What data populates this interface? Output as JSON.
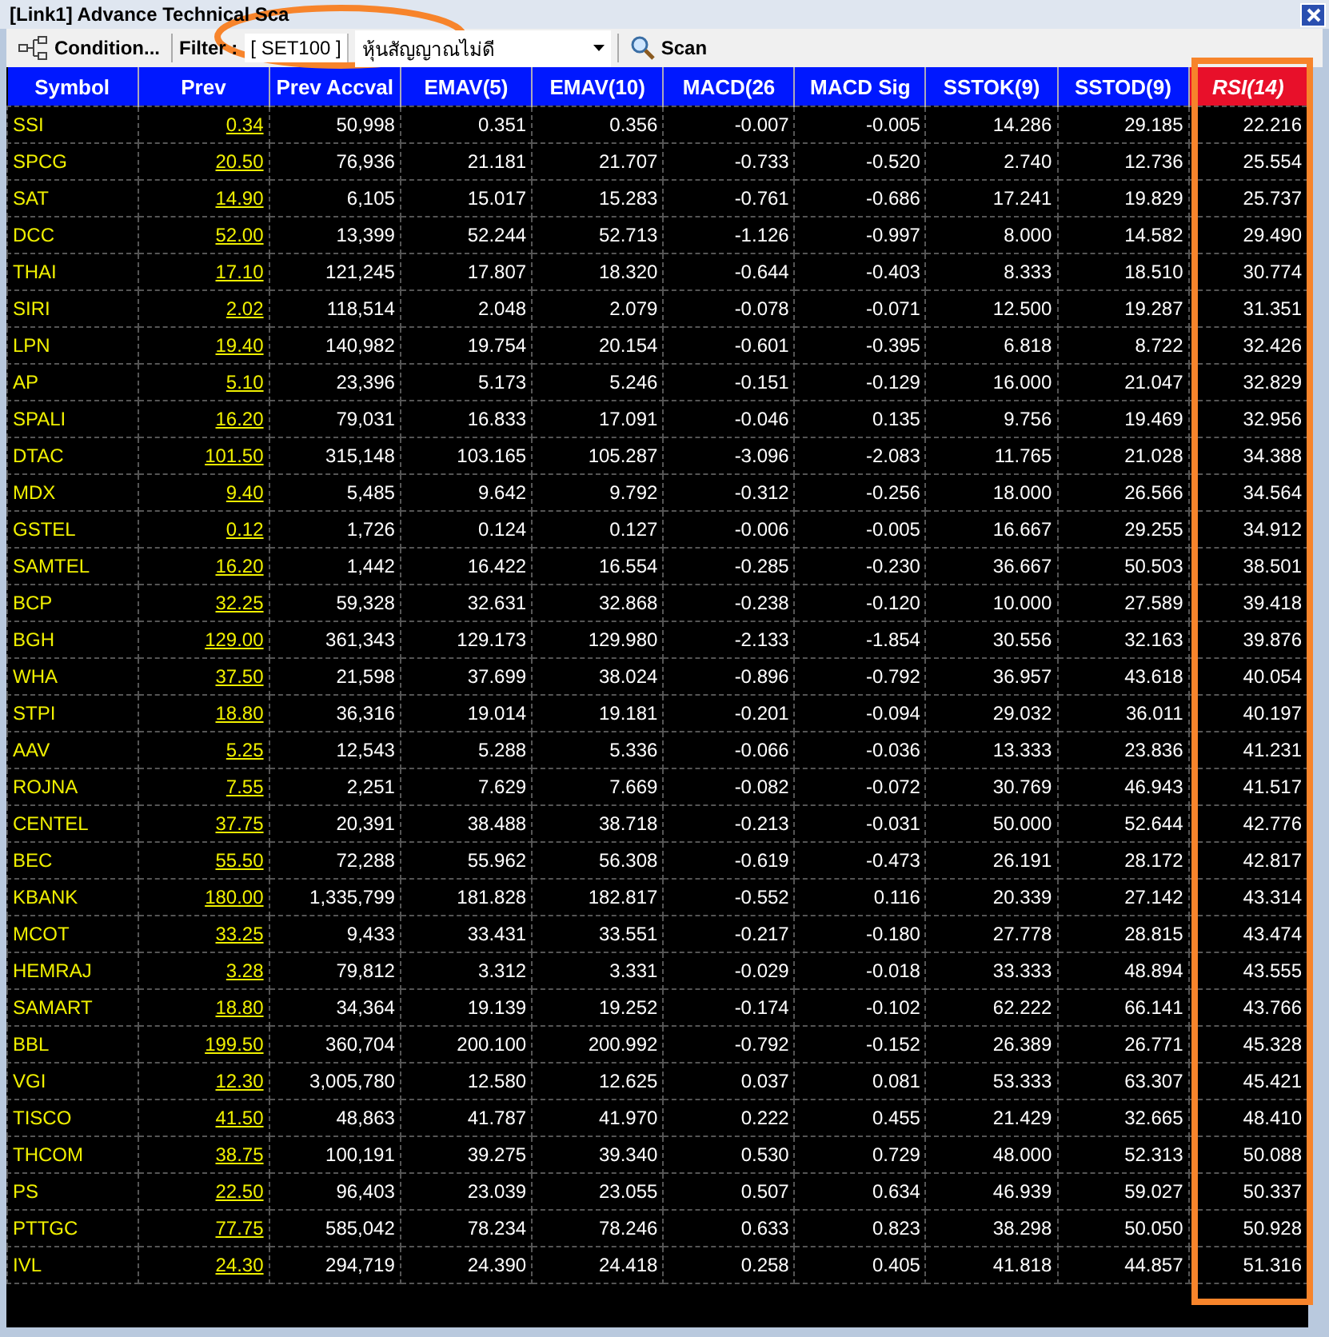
{
  "window": {
    "title": "[Link1] Advance Technical Sca"
  },
  "toolbar": {
    "condition_button": "Condition...",
    "filter_label": "Filter :",
    "filter_value": "[ SET100 ]",
    "signal_dropdown": "หุ้นสัญญาณไม่ดี",
    "scan_button": "Scan"
  },
  "table": {
    "columns": [
      {
        "label": "Symbol",
        "kind": "symbol",
        "sorted": false
      },
      {
        "label": "Prev",
        "kind": "link",
        "sorted": false
      },
      {
        "label": "Prev Accval",
        "kind": "number",
        "sorted": false
      },
      {
        "label": "EMAV(5)",
        "kind": "number",
        "sorted": false
      },
      {
        "label": "EMAV(10)",
        "kind": "number",
        "sorted": false
      },
      {
        "label": "MACD(26",
        "kind": "number",
        "sorted": false
      },
      {
        "label": "MACD Sig",
        "kind": "number",
        "sorted": false
      },
      {
        "label": "SSTOK(9)",
        "kind": "number",
        "sorted": false
      },
      {
        "label": "SSTOD(9)",
        "kind": "number",
        "sorted": false
      },
      {
        "label": "RSI(14)",
        "kind": "number",
        "sorted": true
      }
    ],
    "rows": [
      [
        "SSI",
        "0.34",
        "50,998",
        "0.351",
        "0.356",
        "-0.007",
        "-0.005",
        "14.286",
        "29.185",
        "22.216"
      ],
      [
        "SPCG",
        "20.50",
        "76,936",
        "21.181",
        "21.707",
        "-0.733",
        "-0.520",
        "2.740",
        "12.736",
        "25.554"
      ],
      [
        "SAT",
        "14.90",
        "6,105",
        "15.017",
        "15.283",
        "-0.761",
        "-0.686",
        "17.241",
        "19.829",
        "25.737"
      ],
      [
        "DCC",
        "52.00",
        "13,399",
        "52.244",
        "52.713",
        "-1.126",
        "-0.997",
        "8.000",
        "14.582",
        "29.490"
      ],
      [
        "THAI",
        "17.10",
        "121,245",
        "17.807",
        "18.320",
        "-0.644",
        "-0.403",
        "8.333",
        "18.510",
        "30.774"
      ],
      [
        "SIRI",
        "2.02",
        "118,514",
        "2.048",
        "2.079",
        "-0.078",
        "-0.071",
        "12.500",
        "19.287",
        "31.351"
      ],
      [
        "LPN",
        "19.40",
        "140,982",
        "19.754",
        "20.154",
        "-0.601",
        "-0.395",
        "6.818",
        "8.722",
        "32.426"
      ],
      [
        "AP",
        "5.10",
        "23,396",
        "5.173",
        "5.246",
        "-0.151",
        "-0.129",
        "16.000",
        "21.047",
        "32.829"
      ],
      [
        "SPALI",
        "16.20",
        "79,031",
        "16.833",
        "17.091",
        "-0.046",
        "0.135",
        "9.756",
        "19.469",
        "32.956"
      ],
      [
        "DTAC",
        "101.50",
        "315,148",
        "103.165",
        "105.287",
        "-3.096",
        "-2.083",
        "11.765",
        "21.028",
        "34.388"
      ],
      [
        "MDX",
        "9.40",
        "5,485",
        "9.642",
        "9.792",
        "-0.312",
        "-0.256",
        "18.000",
        "26.566",
        "34.564"
      ],
      [
        "GSTEL",
        "0.12",
        "1,726",
        "0.124",
        "0.127",
        "-0.006",
        "-0.005",
        "16.667",
        "29.255",
        "34.912"
      ],
      [
        "SAMTEL",
        "16.20",
        "1,442",
        "16.422",
        "16.554",
        "-0.285",
        "-0.230",
        "36.667",
        "50.503",
        "38.501"
      ],
      [
        "BCP",
        "32.25",
        "59,328",
        "32.631",
        "32.868",
        "-0.238",
        "-0.120",
        "10.000",
        "27.589",
        "39.418"
      ],
      [
        "BGH",
        "129.00",
        "361,343",
        "129.173",
        "129.980",
        "-2.133",
        "-1.854",
        "30.556",
        "32.163",
        "39.876"
      ],
      [
        "WHA",
        "37.50",
        "21,598",
        "37.699",
        "38.024",
        "-0.896",
        "-0.792",
        "36.957",
        "43.618",
        "40.054"
      ],
      [
        "STPI",
        "18.80",
        "36,316",
        "19.014",
        "19.181",
        "-0.201",
        "-0.094",
        "29.032",
        "36.011",
        "40.197"
      ],
      [
        "AAV",
        "5.25",
        "12,543",
        "5.288",
        "5.336",
        "-0.066",
        "-0.036",
        "13.333",
        "23.836",
        "41.231"
      ],
      [
        "ROJNA",
        "7.55",
        "2,251",
        "7.629",
        "7.669",
        "-0.082",
        "-0.072",
        "30.769",
        "46.943",
        "41.517"
      ],
      [
        "CENTEL",
        "37.75",
        "20,391",
        "38.488",
        "38.718",
        "-0.213",
        "-0.031",
        "50.000",
        "52.644",
        "42.776"
      ],
      [
        "BEC",
        "55.50",
        "72,288",
        "55.962",
        "56.308",
        "-0.619",
        "-0.473",
        "26.191",
        "28.172",
        "42.817"
      ],
      [
        "KBANK",
        "180.00",
        "1,335,799",
        "181.828",
        "182.817",
        "-0.552",
        "0.116",
        "20.339",
        "27.142",
        "43.314"
      ],
      [
        "MCOT",
        "33.25",
        "9,433",
        "33.431",
        "33.551",
        "-0.217",
        "-0.180",
        "27.778",
        "28.815",
        "43.474"
      ],
      [
        "HEMRAJ",
        "3.28",
        "79,812",
        "3.312",
        "3.331",
        "-0.029",
        "-0.018",
        "33.333",
        "48.894",
        "43.555"
      ],
      [
        "SAMART",
        "18.80",
        "34,364",
        "19.139",
        "19.252",
        "-0.174",
        "-0.102",
        "62.222",
        "66.141",
        "43.766"
      ],
      [
        "BBL",
        "199.50",
        "360,704",
        "200.100",
        "200.992",
        "-0.792",
        "-0.152",
        "26.389",
        "26.771",
        "45.328"
      ],
      [
        "VGI",
        "12.30",
        "3,005,780",
        "12.580",
        "12.625",
        "0.037",
        "0.081",
        "53.333",
        "63.307",
        "45.421"
      ],
      [
        "TISCO",
        "41.50",
        "48,863",
        "41.787",
        "41.970",
        "0.222",
        "0.455",
        "21.429",
        "32.665",
        "48.410"
      ],
      [
        "THCOM",
        "38.75",
        "100,191",
        "39.275",
        "39.340",
        "0.530",
        "0.729",
        "48.000",
        "52.313",
        "50.088"
      ],
      [
        "PS",
        "22.50",
        "96,403",
        "23.039",
        "23.055",
        "0.507",
        "0.634",
        "46.939",
        "59.027",
        "50.337"
      ],
      [
        "PTTGC",
        "77.75",
        "585,042",
        "78.234",
        "78.246",
        "0.633",
        "0.823",
        "38.298",
        "50.050",
        "50.928"
      ],
      [
        "IVL",
        "24.30",
        "294,719",
        "24.390",
        "24.418",
        "0.258",
        "0.405",
        "41.818",
        "44.857",
        "51.316"
      ]
    ]
  }
}
